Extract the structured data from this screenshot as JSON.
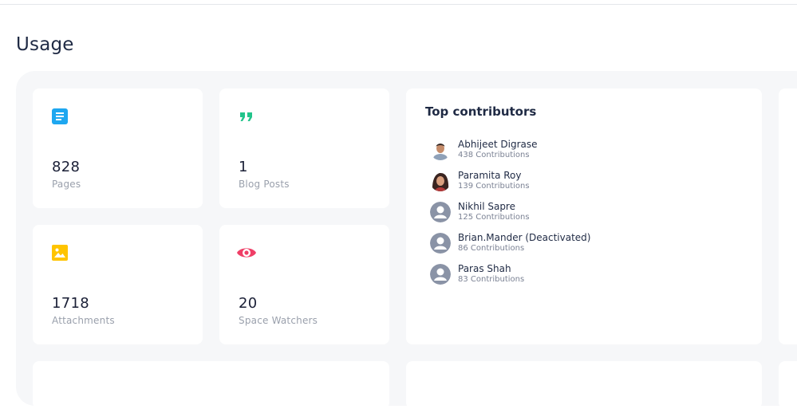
{
  "page": {
    "title": "Usage"
  },
  "stats": [
    {
      "icon": "pages-icon",
      "value": "828",
      "label": "Pages",
      "color": "#1ea7f0"
    },
    {
      "icon": "quote-icon",
      "value": "1",
      "label": "Blog Posts",
      "color": "#22c48b"
    },
    {
      "icon": "image-icon",
      "value": "1718",
      "label": "Attachments",
      "color": "#ffc400"
    },
    {
      "icon": "eye-icon",
      "value": "20",
      "label": "Space Watchers",
      "color": "#ef3e66"
    }
  ],
  "contributors": {
    "title": "Top contributors",
    "items": [
      {
        "name": "Abhijeet Digrase",
        "count": "438 Contributions",
        "avatar": "photo-avatar"
      },
      {
        "name": "Paramita Roy",
        "count": "139 Contributions",
        "avatar": "photo-avatar"
      },
      {
        "name": "Nikhil Sapre",
        "count": "125 Contributions",
        "avatar": "default-avatar-icon"
      },
      {
        "name": "Brian.Mander (Deactivated)",
        "count": "86 Contributions",
        "avatar": "default-avatar-icon"
      },
      {
        "name": "Paras Shah",
        "count": "83 Contributions",
        "avatar": "default-avatar-icon"
      }
    ]
  },
  "colors": {
    "background": "#f6f7f9",
    "card": "#ffffff",
    "muted_text": "#9aa0ac",
    "default_avatar": "#8a93a6"
  }
}
